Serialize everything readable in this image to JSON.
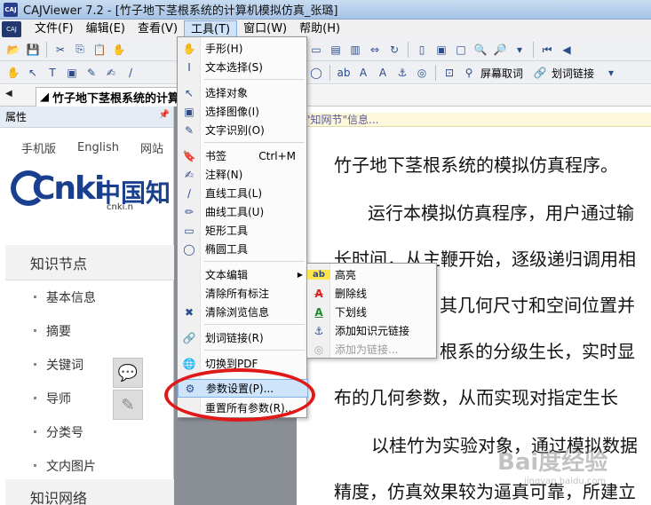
{
  "title_bar": {
    "app_icon_text": "CAJ",
    "title": "CAJViewer 7.2 - [竹子地下茎根系统的计算机模拟仿真_张璐]"
  },
  "menu_bar": {
    "logo_text": "CAJ",
    "items": [
      "文件(F)",
      "编辑(E)",
      "查看(V)",
      "工具(T)",
      "窗口(W)",
      "帮助(H)"
    ],
    "active_index": 3
  },
  "toolbar2": {
    "screen_pick_label": "屏幕取词",
    "word_link_label": "划词链接"
  },
  "tab": {
    "doc_title": "竹子地下茎根系统的计算"
  },
  "left_panel": {
    "header": "属性",
    "site_nav": [
      "手机版",
      "English",
      "网站"
    ],
    "logo_text": "Cnki",
    "logo_zh": "中国知",
    "logo_url": "cnki.n",
    "section1": "知识节点",
    "items": [
      "基本信息",
      "摘要",
      "关键词",
      "导师",
      "分类号",
      "文内图片"
    ],
    "section2": "知识网络"
  },
  "doc": {
    "infobar": "\"知网节\"信息...",
    "lines": [
      "竹子地下茎根系统的模拟仿真程序。",
      "运行本模拟仿真程序，用户通过输",
      "长时间，从主鞭开始，逐级递归调用相",
      "其几何尺寸和空间位置并",
      "根系的分级生长，实时显",
      "布的几何参数，从而实现对指定生长",
      "以桂竹为实验对象，通过模拟数据",
      "精度，仿真效果较为逼真可靠，所建立"
    ]
  },
  "tools_menu": {
    "items": [
      {
        "icon": "✋",
        "label": "手形(H)",
        "shortcut": ""
      },
      {
        "icon": "",
        "label": "文本选择(S)",
        "shortcut": ""
      },
      {
        "icon": "↖",
        "label": "选择对象",
        "shortcut": ""
      },
      {
        "icon": "▣",
        "label": "选择图像(I)",
        "shortcut": ""
      },
      {
        "icon": "✎",
        "label": "文字识别(O)",
        "shortcut": ""
      },
      {
        "icon": "🔖",
        "label": "书签",
        "shortcut": "Ctrl+M"
      },
      {
        "icon": "✍",
        "label": "注释(N)",
        "shortcut": ""
      },
      {
        "icon": "/",
        "label": "直线工具(L)",
        "shortcut": ""
      },
      {
        "icon": "✏",
        "label": "曲线工具(U)",
        "shortcut": ""
      },
      {
        "icon": "▭",
        "label": "矩形工具",
        "shortcut": ""
      },
      {
        "icon": "◯",
        "label": "椭圆工具",
        "shortcut": ""
      },
      {
        "icon": "",
        "label": "文本编辑",
        "shortcut": ""
      },
      {
        "icon": "",
        "label": "清除所有标注",
        "shortcut": ""
      },
      {
        "icon": "✖",
        "label": "清除浏览信息",
        "shortcut": ""
      },
      {
        "icon": "🔗",
        "label": "划词链接(R)",
        "shortcut": ""
      },
      {
        "icon": "🌐",
        "label": "切换到PDF",
        "shortcut": ""
      },
      {
        "icon": "⚙",
        "label": "参数设置(P)...",
        "shortcut": ""
      },
      {
        "icon": "",
        "label": "重置所有参数(R)...",
        "shortcut": ""
      }
    ]
  },
  "text_edit_submenu": {
    "items": [
      {
        "icon": "ab",
        "label": "高亮",
        "disabled": false
      },
      {
        "icon": "A",
        "label": "删除线",
        "disabled": false
      },
      {
        "icon": "A",
        "label": "下划线",
        "disabled": false
      },
      {
        "icon": "⚓",
        "label": "添加知识元链接",
        "disabled": false
      },
      {
        "icon": "◎",
        "label": "添加为链接...",
        "disabled": true
      }
    ]
  },
  "watermark": {
    "text": "Bai度经验",
    "sub": "jingyan.baidu.com"
  },
  "colors": {
    "highlight_red": "#e01818",
    "menu_highlight": "#cde4fb"
  }
}
